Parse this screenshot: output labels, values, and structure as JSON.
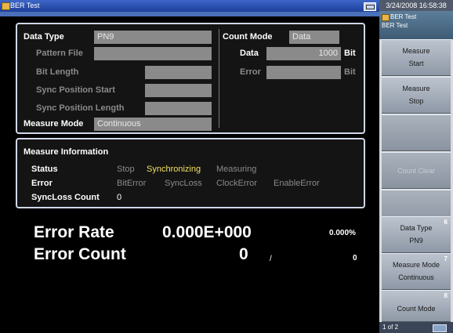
{
  "window": {
    "title": "BER Test"
  },
  "settings": {
    "data_type_label": "Data Type",
    "data_type_value": "PN9",
    "pattern_file_label": "Pattern File",
    "pattern_file_value": "",
    "bit_length_label": "Bit Length",
    "bit_length_value": "",
    "sync_start_label": "Sync Position Start",
    "sync_start_value": "",
    "sync_length_label": "Sync Position Length",
    "sync_length_value": "",
    "measure_mode_label": "Measure Mode",
    "measure_mode_value": "Continuous",
    "count_mode_label": "Count Mode",
    "count_mode_value": "Data",
    "data_label": "Data",
    "data_value": "1000",
    "data_unit": "Bit",
    "error_label": "Error",
    "error_value": "",
    "error_unit": "Bit"
  },
  "info": {
    "title": "Measure Information",
    "status_label": "Status",
    "status_items": [
      "Stop",
      "Synchronizing",
      "Measuring"
    ],
    "status_active": "Synchronizing",
    "error_label": "Error",
    "error_items": [
      "BitError",
      "SyncLoss",
      "ClockError",
      "EnableError"
    ],
    "syncloss_label": "SyncLoss Count",
    "syncloss_value": "0"
  },
  "results": {
    "error_rate_label": "Error Rate",
    "error_rate_value": "0.000E+000",
    "error_rate_percent": "0.000%",
    "error_count_label": "Error Count",
    "error_count_value": "0",
    "separator": "/",
    "error_count_total": "0"
  },
  "sidebar": {
    "clock": "3/24/2008 16:58:38",
    "header_line1": "BER Test",
    "header_line2": "BER Test",
    "buttons": [
      {
        "line1": "Measure",
        "line2": "Start",
        "num": ""
      },
      {
        "line1": "Measure",
        "line2": "Stop",
        "num": ""
      },
      {
        "line1": "",
        "line2": "",
        "num": ""
      },
      {
        "line1": "Count Clear",
        "line2": "",
        "num": ""
      },
      {
        "line1": "",
        "line2": "",
        "num": ""
      },
      {
        "line1": "Data Type",
        "line2": "PN9",
        "num": "6"
      },
      {
        "line1": "Measure Mode",
        "line2": "Continuous",
        "num": "7"
      },
      {
        "line1": "Count Mode",
        "line2": "",
        "num": "8"
      }
    ],
    "page": "1 of 2"
  },
  "colors": {
    "titlebar": "#2a4fa8",
    "panel_border": "#cfd8e8",
    "field_bg": "#8a8a8a",
    "active_status": "#f0e060",
    "inactive_text": "#8a8a8a"
  }
}
